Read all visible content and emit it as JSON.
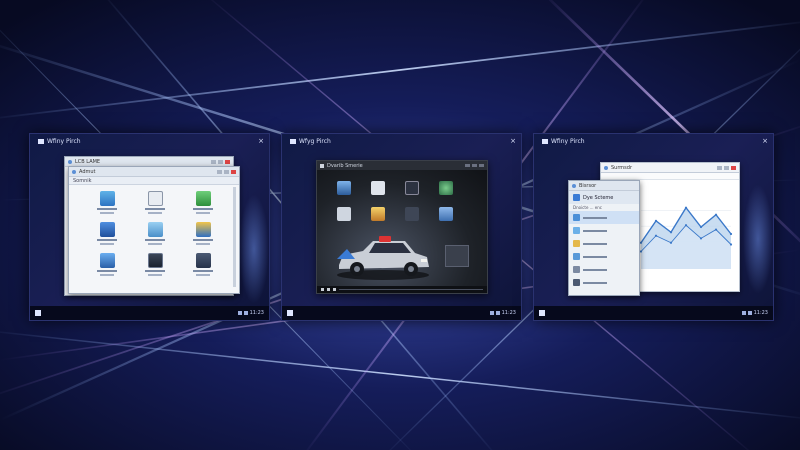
{
  "desktops": [
    {
      "title": "Wfiny Pirch",
      "windows": {
        "back_title": "LCB LAME",
        "front_title": "Admut",
        "toolbar": "Somnik"
      },
      "tray_time": "11:23"
    },
    {
      "title": "Wfyg Pirch",
      "windows": {
        "media_title": "Dvarib Smerie"
      },
      "tray_time": "11:23"
    },
    {
      "title": "Wfiny Pirch",
      "windows": {
        "chart_title": "Surmsdr",
        "side_title": "Bisrsor",
        "side_item": "Dye Scteme",
        "side_sub": "Dnoicte ... enc"
      },
      "tray_time": "11:23"
    }
  ],
  "colors": {
    "desktop_bg": "#101a45",
    "accent_blue": "#3a7bd5",
    "chart_line": "#3a78c9",
    "chart_fill": "#bcd4ee"
  },
  "chart_data": {
    "type": "area",
    "series": [
      {
        "values": [
          30,
          55,
          42,
          70,
          48,
          62,
          40
        ]
      },
      {
        "values": [
          20,
          38,
          30,
          50,
          35,
          45,
          28
        ]
      }
    ]
  }
}
